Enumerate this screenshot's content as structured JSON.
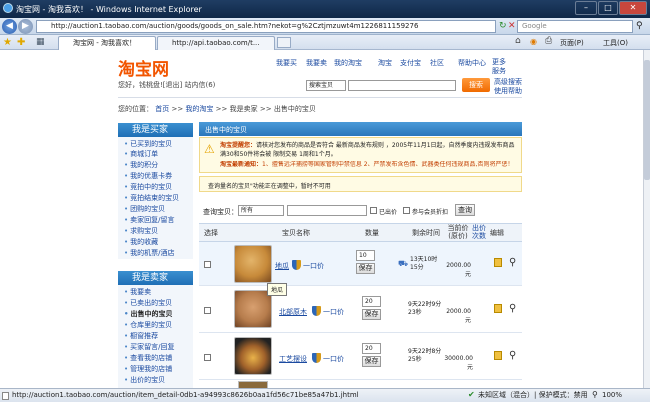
{
  "window": {
    "title": "淘宝网 - 淘我喜欢！ - Windows Internet Explorer"
  },
  "address": {
    "url": "http://auction1.taobao.com/auction/goods/goods_on_sale.htm?nekot=g%2Cztjmzuwt4m1226811159276",
    "search_placeholder": "Google"
  },
  "tabs": [
    {
      "label": "淘宝网 - 淘我喜欢！"
    },
    {
      "label": "http://api.taobao.com/t..."
    }
  ],
  "toolbar": {
    "page": "页面(P)",
    "tools": "工具(O)"
  },
  "header": {
    "logo": "淘宝网",
    "greeting": "您好，钱桃盘![退出] 站内信(6)",
    "nav": [
      "我要买",
      "我要卖",
      "我的淘宝",
      "淘宝",
      "支付宝",
      "社区",
      "帮助中心",
      "更多服务"
    ],
    "search_select": "搜索宝贝",
    "search_button": "搜索",
    "adv_search": "高级搜索",
    "help": "使用帮助"
  },
  "breadcrumb": {
    "prefix": "您的位置：",
    "items": [
      "首页",
      ">>",
      "我的淘宝",
      ">>",
      "我是卖家",
      ">>",
      "出售中的宝贝"
    ]
  },
  "sidebar": {
    "buyer_title": "我是买家",
    "buyer_items": [
      "已买到的宝贝",
      "商城订单",
      "我的积分",
      "我的优惠卡券",
      "竞拍中的宝贝",
      "竞拍结束的宝贝",
      "团购的宝贝",
      "卖家回复/留言",
      "求购宝贝",
      "我的收藏",
      "我的机票/酒店"
    ],
    "seller_title": "我是卖家",
    "seller_items": [
      "我要卖",
      "已卖出的宝贝",
      "出售中的宝贝",
      "仓库里的宝贝",
      "橱窗推荐",
      "买家留言/回复",
      "查看我的店铺",
      "管理我的店铺",
      "出价的宝贝"
    ]
  },
  "panel": {
    "title": "出售中的宝贝",
    "notice1_label": "淘宝提醒您：",
    "notice1_text": "请核对您发布的商品是否符合 最新商品发布规则 ，2005年11月1日起，自然季度内违规发布商品满30和50件将会被 限制交易 1周和1个月。",
    "notice2_label": "淘宝最新通知：",
    "notice2_text": "1、擅售远洋捕捞等国家管制中禁信息  2、严禁发布含色情、武器类任何违规商品,否则将严惩！",
    "info": "查询量名的宝贝\"功能正在调整中，暂时不可用",
    "query_label": "查询宝贝：",
    "query_select": "所有",
    "chk_discount": "已出价",
    "chk_member": "参与会员折扣",
    "query_button": "查询"
  },
  "table": {
    "headers": [
      "选择",
      "宝贝名称",
      "数量",
      "剩余时间",
      "当前价(原价)",
      "出价次数",
      "编辑"
    ],
    "rows": [
      {
        "name": "地瓜",
        "type": "一口价",
        "qty": "10",
        "save": "保存",
        "time": "13天10时15分",
        "price": "2000.00元",
        "img_color": "#c78a3a"
      },
      {
        "name": "北部原木",
        "type": "一口价",
        "qty": "20",
        "save": "保存",
        "time": "9天22时9分23秒",
        "price": "2000.00元",
        "img_color": "#b67c4c"
      },
      {
        "name": "工艺摆设",
        "type": "一口价",
        "qty": "20",
        "save": "保存",
        "time": "9天22时8分25秒",
        "price": "30000.00元",
        "img_color": "#6a4a2a"
      }
    ],
    "tooltip": "地瓜"
  },
  "status": {
    "link": "http://auction1.taobao.com/auction/item_detail-0db1-a94993c8626b0aa1fd56c71be85a47b1.jhtml",
    "zone": "未知区域（混合）| 保护模式：禁用",
    "zoom": "100%"
  }
}
